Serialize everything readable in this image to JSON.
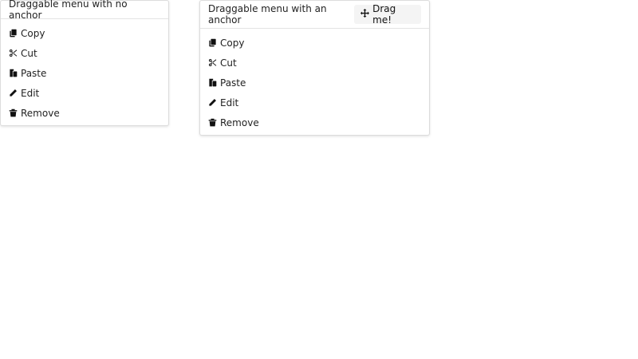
{
  "menus": [
    {
      "title": "Draggable menu with no anchor",
      "items": [
        {
          "label": "Copy",
          "icon": "copy-icon"
        },
        {
          "label": "Cut",
          "icon": "cut-icon"
        },
        {
          "label": "Paste",
          "icon": "paste-icon"
        },
        {
          "label": "Edit",
          "icon": "edit-icon"
        },
        {
          "label": "Remove",
          "icon": "remove-icon"
        }
      ]
    },
    {
      "title": "Draggable menu with an anchor",
      "anchor_label": "Drag me!",
      "anchor_icon": "move-icon",
      "items": [
        {
          "label": "Copy",
          "icon": "copy-icon"
        },
        {
          "label": "Cut",
          "icon": "cut-icon"
        },
        {
          "label": "Paste",
          "icon": "paste-icon"
        },
        {
          "label": "Edit",
          "icon": "edit-icon"
        },
        {
          "label": "Remove",
          "icon": "remove-icon"
        }
      ]
    }
  ]
}
